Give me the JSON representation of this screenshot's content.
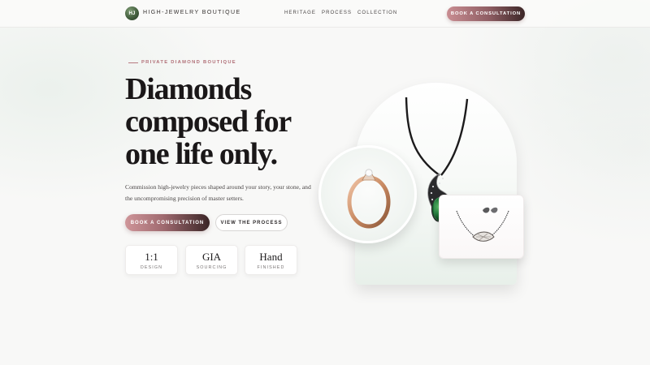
{
  "nav": {
    "logo_initials": "HJ",
    "brand": "HIGH-JEWELRY BOUTIQUE",
    "links": [
      "HERITAGE",
      "PROCESS",
      "COLLECTION"
    ],
    "cta": "BOOK A CONSULTATION"
  },
  "hero": {
    "eyebrow": "PRIVATE DIAMOND BOUTIQUE",
    "headline_lines": [
      "Diamonds",
      "composed for",
      "one life only."
    ],
    "lede": "Commission high-jewelry pieces shaped around your story, your stone, and the uncompromising precision of master setters.",
    "primary_button": "BOOK A CONSULTATION",
    "secondary_button": "VIEW THE PROCESS",
    "stats": [
      {
        "value": "1:1",
        "label": "DESIGN"
      },
      {
        "value": "GIA",
        "label": "SOURCING"
      },
      {
        "value": "Hand",
        "label": "FINISHED"
      }
    ]
  },
  "visual": {
    "items": [
      "emerald-pendant-necklace",
      "solitaire-ring",
      "necklace-earring-set"
    ]
  },
  "colors": {
    "accent": "#b06e76",
    "cta_start": "#cf9599",
    "cta_end": "#3a2526",
    "background": "#f8f8f7",
    "emerald": "#1f7a3a"
  }
}
